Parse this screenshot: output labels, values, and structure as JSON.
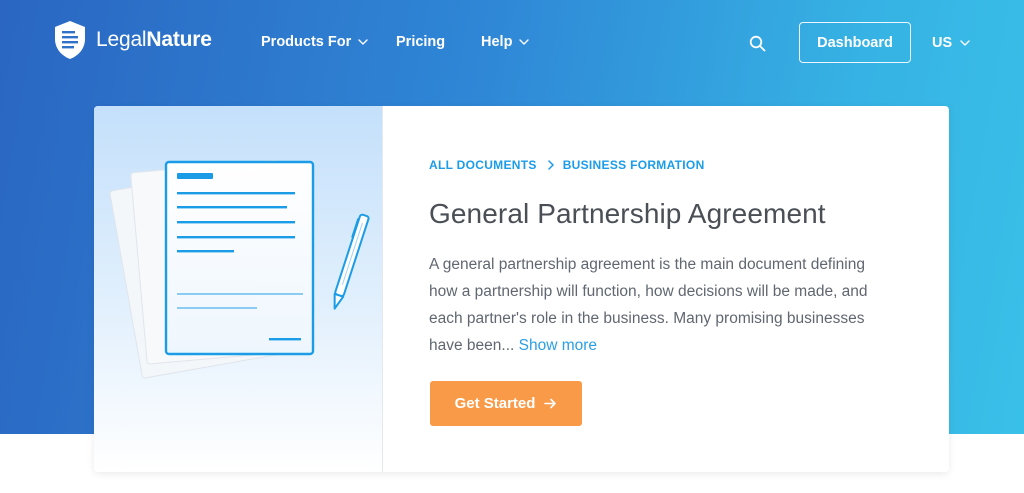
{
  "header": {
    "logo_light": "Legal",
    "logo_bold": "Nature",
    "nav": [
      {
        "label": "Products For",
        "has_dropdown": true
      },
      {
        "label": "Pricing",
        "has_dropdown": false
      },
      {
        "label": "Help",
        "has_dropdown": true
      }
    ],
    "search_icon": "search-icon",
    "dashboard_label": "Dashboard",
    "locale": "US"
  },
  "document": {
    "breadcrumb": [
      "ALL DOCUMENTS",
      "BUSINESS FORMATION"
    ],
    "title": "General Partnership Agreement",
    "description": "A general partnership agreement is the main document defining how a partnership will function, how decisions will be made, and each partner's role in the business. Many promising businesses have been...",
    "show_more": "Show more",
    "cta_label": "Get Started",
    "illustration": "document-and-pen-illustration"
  },
  "colors": {
    "hero_start": "#2a66c2",
    "hero_end": "#39c0e8",
    "accent_blue": "#1b9ce8",
    "cta_orange": "#f89a48",
    "title_gray": "#4a4f56"
  }
}
